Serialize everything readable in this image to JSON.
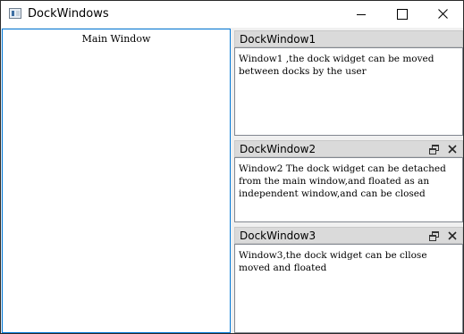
{
  "window": {
    "title": "DockWindows",
    "app_icon": "window-app-icon",
    "controls": {
      "minimize": "minimize-icon",
      "maximize": "maximize-icon",
      "close": "close-icon"
    }
  },
  "main": {
    "label": "Main Window"
  },
  "docks": [
    {
      "title": "DockWindow1",
      "text": "Window1 ,the dock widget can be moved\nbetween docks by the user",
      "buttons": []
    },
    {
      "title": "DockWindow2",
      "text": "Window2 The dock widget can be detached\nfrom the main window,and floated as an\nindependent window,and can be closed",
      "buttons": [
        "float-icon",
        "close-icon"
      ]
    },
    {
      "title": "DockWindow3",
      "text": "Window3,the dock widget can be cllose\nmoved and floated",
      "buttons": [
        "float-icon",
        "close-icon"
      ]
    }
  ],
  "colors": {
    "titlebar_bg": "#ffffff",
    "window_bg": "#f0f0f0",
    "focus_border": "#0078d7",
    "dock_title_bg": "#dadada",
    "dock_border": "#828790"
  }
}
